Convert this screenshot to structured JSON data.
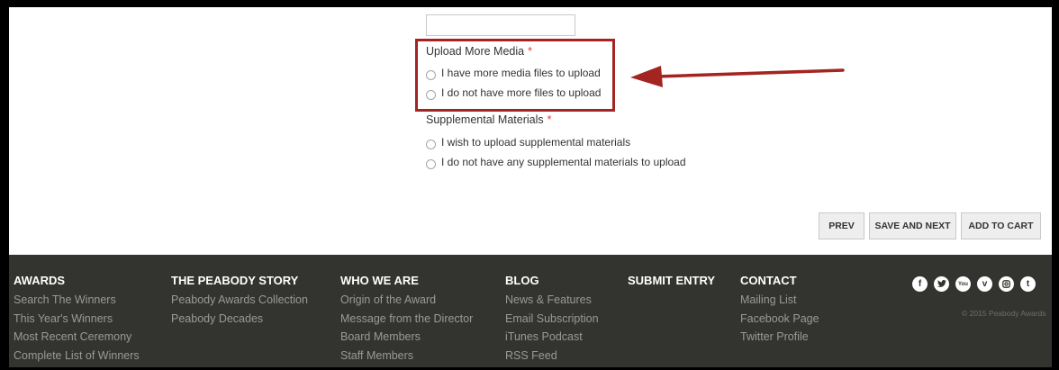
{
  "form": {
    "upload_more_media": {
      "label": "Upload More Media",
      "required_mark": "*",
      "options": [
        "I have more media files to upload",
        "I do not have more files to upload"
      ]
    },
    "supplemental_materials": {
      "label": "Supplemental Materials",
      "required_mark": "*",
      "options": [
        "I wish to upload supplemental materials",
        "I do not have any supplemental materials to upload"
      ]
    }
  },
  "annotation": {
    "highlight_color": "#a32420"
  },
  "buttons": {
    "prev": "PREV",
    "save_next": "SAVE AND NEXT",
    "add_to_cart": "ADD TO CART"
  },
  "footer": {
    "columns": [
      {
        "heading": "AWARDS",
        "links": [
          "Search The Winners",
          "This Year's Winners",
          "Most Recent Ceremony",
          "Complete List of Winners"
        ]
      },
      {
        "heading": "THE PEABODY STORY",
        "links": [
          "Peabody Awards Collection",
          "Peabody Decades"
        ]
      },
      {
        "heading": "WHO WE ARE",
        "links": [
          "Origin of the Award",
          "Message from the Director",
          "Board Members",
          "Staff Members"
        ]
      },
      {
        "heading": "BLOG",
        "links": [
          "News & Features",
          "Email Subscription",
          "iTunes Podcast",
          "RSS Feed"
        ]
      },
      {
        "heading": "SUBMIT ENTRY",
        "links": []
      },
      {
        "heading": "CONTACT",
        "links": [
          "Mailing List",
          "Facebook Page",
          "Twitter Profile"
        ]
      }
    ],
    "social_icons": [
      "facebook-icon",
      "twitter-icon",
      "youtube-icon",
      "vimeo-icon",
      "instagram-icon",
      "tumblr-icon"
    ],
    "copyright": "© 2015 Peabody Awards"
  }
}
